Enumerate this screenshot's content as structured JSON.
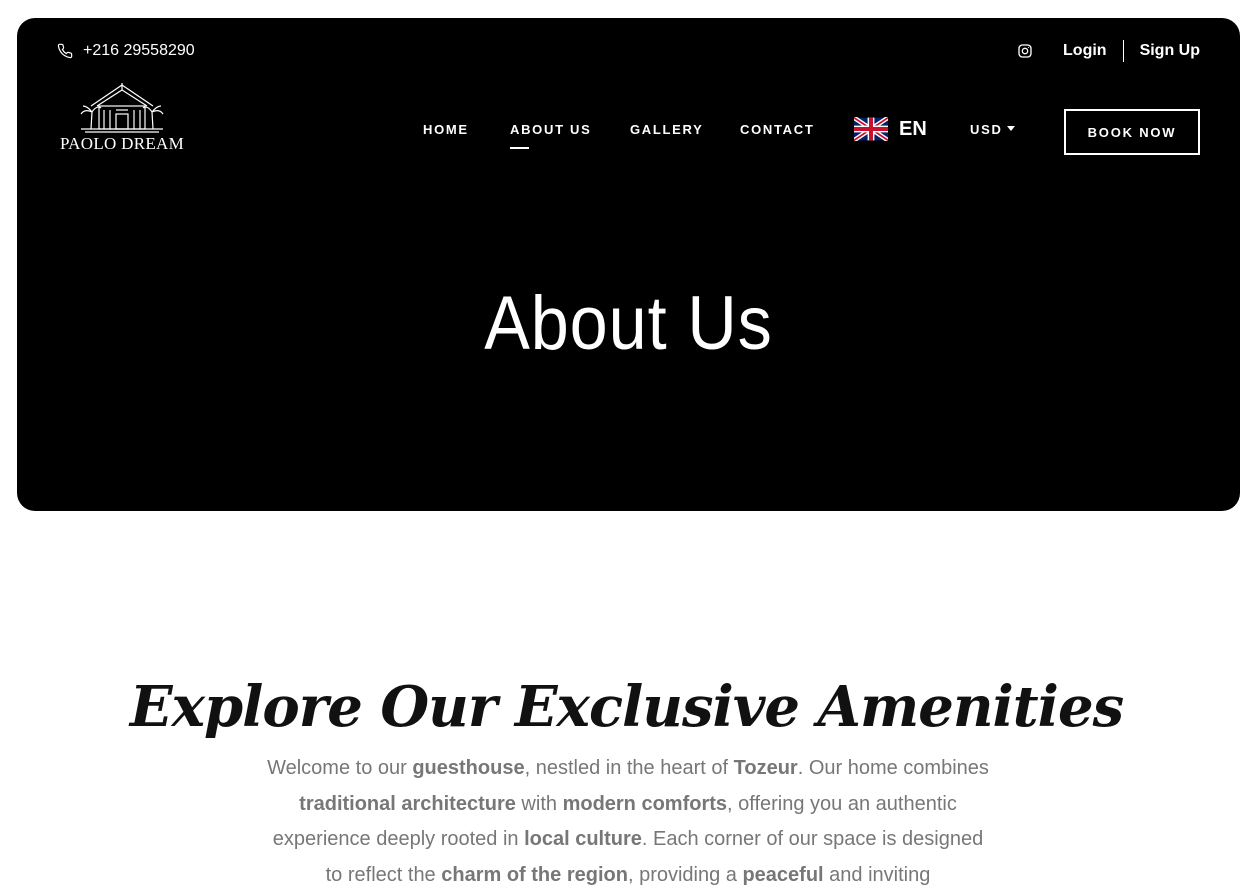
{
  "topbar": {
    "phone": "+216 29558290",
    "phone_icon": "phone-icon",
    "instagram_icon": "instagram-icon",
    "login": "Login",
    "signup": "Sign Up"
  },
  "brand": {
    "name": "PAOLO DREAM"
  },
  "nav": {
    "home": "HOME",
    "about": "ABOUT US",
    "gallery": "GALLERY",
    "contact": "CONTACT",
    "active": "ABOUT US"
  },
  "language": {
    "code": "EN",
    "flag_icon": "uk-flag-icon"
  },
  "currency": {
    "code": "USD"
  },
  "book_button": "BOOK NOW",
  "hero": {
    "title": "About Us"
  },
  "section": {
    "heading": "Explore Our Exclusive Amenities",
    "intro": [
      {
        "t": "Welcome to our ",
        "b": false
      },
      {
        "t": "guesthouse",
        "b": true
      },
      {
        "t": ", nestled in the heart of ",
        "b": false
      },
      {
        "t": "Tozeur",
        "b": true
      },
      {
        "t": ". Our home combines ",
        "b": false
      },
      {
        "t": "traditional architecture",
        "b": true
      },
      {
        "t": " with ",
        "b": false
      },
      {
        "t": "modern comforts",
        "b": true
      },
      {
        "t": ", offering you an authentic experience deeply rooted in ",
        "b": false
      },
      {
        "t": "local culture",
        "b": true
      },
      {
        "t": ". Each corner of our space is designed to reflect the ",
        "b": false
      },
      {
        "t": "charm of the region",
        "b": true
      },
      {
        "t": ", providing a ",
        "b": false
      },
      {
        "t": "peaceful",
        "b": true
      },
      {
        "t": " and inviting",
        "b": false
      }
    ]
  },
  "colors": {
    "hero_bg": "#000000",
    "text_muted": "#777777"
  }
}
